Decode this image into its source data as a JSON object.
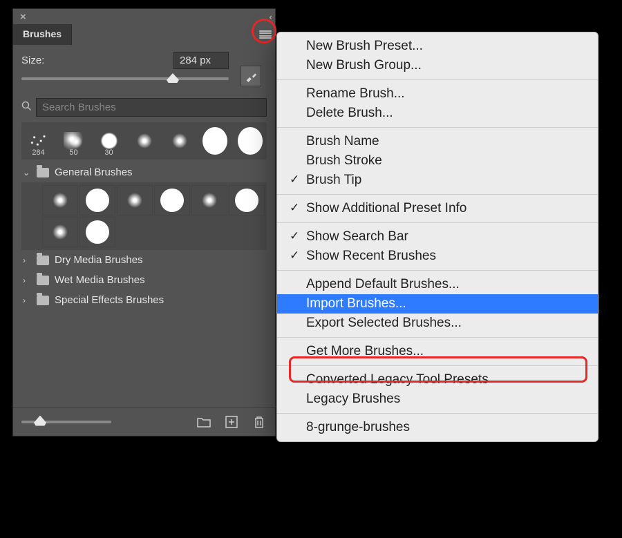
{
  "panel": {
    "tab_label": "Brushes",
    "size_label": "Size:",
    "size_value": "284 px",
    "search_placeholder": "Search Brushes",
    "recent": [
      {
        "kind": "scatter",
        "label": "284"
      },
      {
        "kind": "texture1",
        "label": "50"
      },
      {
        "kind": "texture2",
        "label": "30"
      },
      {
        "kind": "soft",
        "label": ""
      },
      {
        "kind": "soft",
        "label": ""
      },
      {
        "kind": "hard-big",
        "label": ""
      },
      {
        "kind": "hard-big",
        "label": ""
      }
    ],
    "folders": [
      {
        "name": "General Brushes",
        "open": true
      },
      {
        "name": "Dry Media Brushes",
        "open": false
      },
      {
        "name": "Wet Media Brushes",
        "open": false
      },
      {
        "name": "Special Effects Brushes",
        "open": false
      }
    ],
    "general_grid": [
      "soft",
      "hard",
      "soft",
      "hard",
      "soft",
      "hard",
      "soft",
      "hard"
    ]
  },
  "menu": {
    "items": [
      {
        "label": "New Brush Preset...",
        "chk": false,
        "hl": false
      },
      {
        "label": "New Brush Group...",
        "chk": false,
        "hl": false
      },
      {
        "sep": true
      },
      {
        "label": "Rename Brush...",
        "chk": false,
        "hl": false
      },
      {
        "label": "Delete Brush...",
        "chk": false,
        "hl": false
      },
      {
        "sep": true
      },
      {
        "label": "Brush Name",
        "chk": false,
        "hl": false
      },
      {
        "label": "Brush Stroke",
        "chk": false,
        "hl": false
      },
      {
        "label": "Brush Tip",
        "chk": true,
        "hl": false
      },
      {
        "sep": true
      },
      {
        "label": "Show Additional Preset Info",
        "chk": true,
        "hl": false
      },
      {
        "sep": true
      },
      {
        "label": "Show Search Bar",
        "chk": true,
        "hl": false
      },
      {
        "label": "Show Recent Brushes",
        "chk": true,
        "hl": false
      },
      {
        "sep": true
      },
      {
        "label": "Append Default Brushes...",
        "chk": false,
        "hl": false
      },
      {
        "label": "Import Brushes...",
        "chk": false,
        "hl": true
      },
      {
        "label": "Export Selected Brushes...",
        "chk": false,
        "hl": false
      },
      {
        "sep": true
      },
      {
        "label": "Get More Brushes...",
        "chk": false,
        "hl": false
      },
      {
        "sep": true
      },
      {
        "label": "Converted Legacy Tool Presets",
        "chk": false,
        "hl": false
      },
      {
        "label": "Legacy Brushes",
        "chk": false,
        "hl": false
      },
      {
        "sep": true
      },
      {
        "label": "8-grunge-brushes",
        "chk": false,
        "hl": false
      }
    ]
  }
}
